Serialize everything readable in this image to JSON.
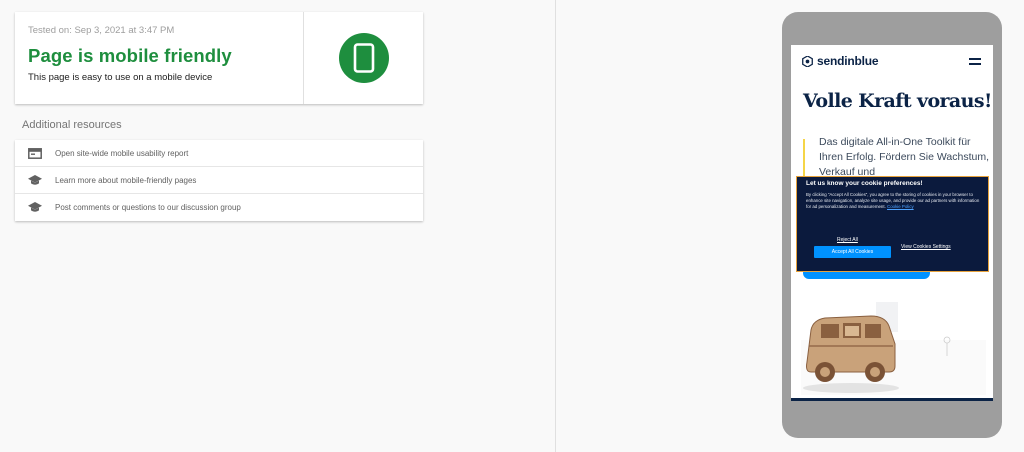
{
  "result": {
    "tested_on": "Tested on: Sep 3, 2021 at 3:47 PM",
    "title": "Page is mobile friendly",
    "subtitle": "This page is easy to use on a mobile device",
    "icon": "smartphone-icon",
    "accent_color": "#1e8e3e"
  },
  "resources": {
    "heading": "Additional resources",
    "items": [
      {
        "icon": "report-icon",
        "label": "Open site-wide mobile usability report"
      },
      {
        "icon": "school-icon",
        "label": "Learn more about mobile-friendly pages"
      },
      {
        "icon": "school-icon",
        "label": "Post comments or questions to our discussion group"
      }
    ]
  },
  "preview": {
    "logo_text": "sendinblue",
    "hero_title": "Volle Kraft voraus!",
    "hero_copy": "Das digitale All-in-One Toolkit für Ihren Erfolg. Fördern Sie Wachstum, Verkauf und",
    "cookie_banner": {
      "title": "Let us know your cookie preferences!",
      "body": "By clicking “Accept All Cookies”, you agree to the storing of cookies in your browser to enhance site navigation, analyze site usage, and provide our ad partners with information for ad personalization and measurement.",
      "policy_link": "Cookie Policy",
      "reject_label": "Reject All",
      "accept_label": "Accept All Cookies",
      "settings_label": "View Cookies Settings"
    },
    "colors": {
      "brand_navy": "#0b2346",
      "brand_blue": "#0092ff",
      "banner_border": "#e6a23c"
    }
  }
}
